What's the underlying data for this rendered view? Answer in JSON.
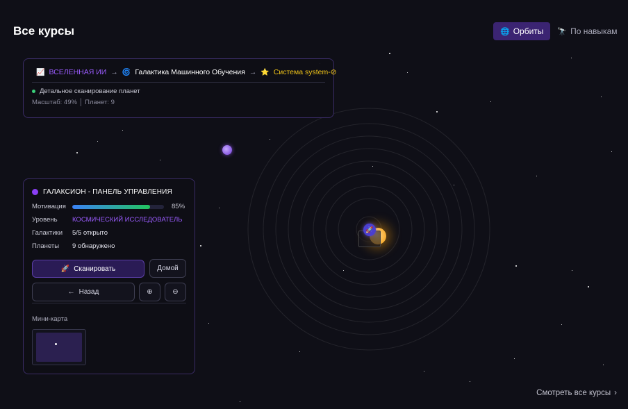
{
  "page": {
    "title": "Все курсы"
  },
  "view_toggle": {
    "orbits_label": "Орбиты",
    "skills_label": "По навыкам"
  },
  "breadcrumb": {
    "universe": "ВСЕЛЕННАЯ ИИ",
    "galaxy": "Галактика Машинного Обучения",
    "system": "Система system-⊘",
    "status": "Детальное сканирование планет",
    "meta": "Масштаб: 49% │ Планет: 9"
  },
  "control_panel": {
    "title": "ГАЛАКСИОН - ПАНЕЛЬ УПРАВЛЕНИЯ",
    "motivation_label": "Мотивация",
    "motivation_value": 0.85,
    "motivation_text": "85%",
    "level_label": "Уровень",
    "level_value": "КОСМИЧЕСКИЙ ИССЛЕДОВАТЕЛЬ",
    "galaxies_label": "Галактики",
    "galaxies_value": "5/5 открыто",
    "planets_label": "Планеты",
    "planets_value": "9 обнаружено",
    "scan_label": "Сканировать",
    "home_label": "Домой",
    "back_label": "Назад",
    "minimap_label": "Мини-карта"
  },
  "footer": {
    "view_all": "Смотреть все курсы"
  },
  "colors": {
    "accent": "#9b5cff",
    "progress_start": "#3b82f6",
    "progress_end": "#22c55e",
    "system": "#f0c419"
  }
}
